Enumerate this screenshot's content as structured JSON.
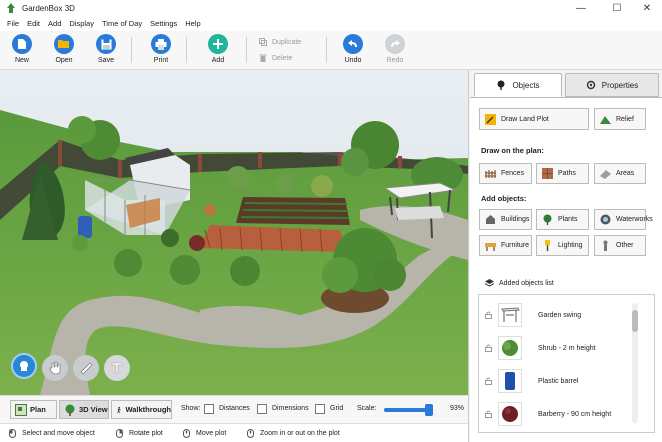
{
  "window": {
    "title": "GardenBox 3D",
    "minimize": "—",
    "maximize": "☐",
    "close": "✕"
  },
  "menu": [
    "File",
    "Edit",
    "Add",
    "Display",
    "Time of Day",
    "Settings",
    "Help"
  ],
  "toolbar": {
    "new": "New",
    "open": "Open",
    "save": "Save",
    "print": "Print",
    "add": "Add",
    "duplicate": "Duplicate",
    "delete": "Delete",
    "undo": "Undo",
    "redo": "Redo"
  },
  "panel": {
    "tabs": {
      "objects": "Objects",
      "properties": "Properties",
      "active": "objects"
    },
    "draw_land_plot": "Draw Land Plot",
    "relief": "Relief",
    "draw_on_plan_heading": "Draw on the plan:",
    "fences": "Fences",
    "paths": "Paths",
    "areas": "Areas",
    "add_objects_heading": "Add objects:",
    "buildings": "Buildings",
    "plants": "Plants",
    "waterworks": "Waterworks",
    "furniture": "Furniture",
    "lighting": "Lighting",
    "other": "Other",
    "added_list_heading": "Added objects list",
    "added_objects": [
      {
        "name": "Garden swing",
        "icon": "swing-thumb"
      },
      {
        "name": "Shrub - 2 m height",
        "icon": "shrub-thumb"
      },
      {
        "name": "Plastic barrel",
        "icon": "barrel-thumb"
      },
      {
        "name": "Barberry - 90 cm height",
        "icon": "barberry-thumb"
      }
    ]
  },
  "viewbar": {
    "plan": "Plan",
    "view3d": "3D View",
    "walkthrough": "Walkthrough",
    "active": "3D View",
    "show_label": "Show:",
    "distances": "Distances",
    "dimensions": "Dimensions",
    "grid": "Grid",
    "scale_label": "Scale:",
    "scale_value": "93%",
    "scale_fraction": 0.93
  },
  "status": {
    "select": "Select and move object",
    "rotate": "Rotate plot",
    "move": "Move plot",
    "zoom": "Zoom in or out on the plot"
  },
  "colors": {
    "accent": "#2a7bd8",
    "grass": "#6fa24a",
    "sky": "#eef3f7"
  }
}
